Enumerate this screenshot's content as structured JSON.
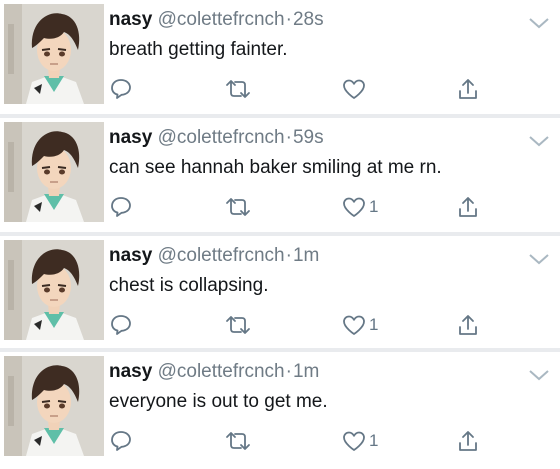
{
  "colors": {
    "text": "#14171a",
    "muted": "#6f7b85",
    "icon": "#657786",
    "separator": "#e9ebee"
  },
  "avatar_icon": "anime-avatar",
  "tweets": [
    {
      "name": "nasy",
      "handle": "@colettefrcnch",
      "dot": "·",
      "time": "28s",
      "text": "breath getting fainter.",
      "likes": ""
    },
    {
      "name": "nasy",
      "handle": "@colettefrcnch",
      "dot": "·",
      "time": "59s",
      "text": "can see hannah baker smiling at me rn.",
      "likes": "1"
    },
    {
      "name": "nasy",
      "handle": "@colettefrcnch",
      "dot": "·",
      "time": "1m",
      "text": "chest is collapsing.",
      "likes": "1"
    },
    {
      "name": "nasy",
      "handle": "@colettefrcnch",
      "dot": "·",
      "time": "1m",
      "text": "everyone is out to get me.",
      "likes": "1"
    }
  ]
}
